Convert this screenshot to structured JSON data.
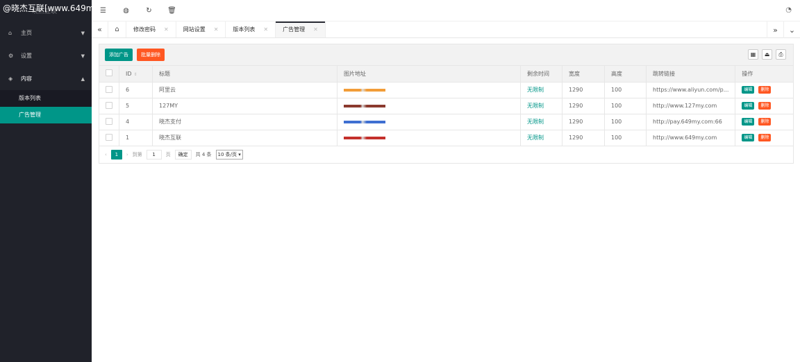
{
  "watermark": "@晓杰互联[www.649m",
  "sidebar": {
    "logo": "晓杰互联",
    "items": [
      {
        "label": "主页",
        "icon": "home-icon"
      },
      {
        "label": "设置",
        "icon": "settings-icon"
      },
      {
        "label": "内容",
        "icon": "diamond-icon"
      }
    ],
    "subitems": [
      {
        "label": "版本列表"
      },
      {
        "label": "广告管理"
      }
    ]
  },
  "tabs": [
    {
      "label": "修改密码"
    },
    {
      "label": "网站设置"
    },
    {
      "label": "版本列表"
    },
    {
      "label": "广告管理"
    }
  ],
  "toolbar": {
    "add_label": "添加广告",
    "batch_delete_label": "批量删除"
  },
  "table": {
    "headers": [
      "ID",
      "标题",
      "图片地址",
      "剩余时间",
      "宽度",
      "高度",
      "跳转链接",
      "操作"
    ],
    "rows": [
      {
        "id": "6",
        "title": "阿里云",
        "remaining": "无限制",
        "width": "1290",
        "height": "100",
        "link": "https://www.aliyun.com/p...",
        "img_color": "#f29d38"
      },
      {
        "id": "5",
        "title": "127MY",
        "remaining": "无限制",
        "width": "1290",
        "height": "100",
        "link": "http://www.127my.com",
        "img_color": "#8b3a2e"
      },
      {
        "id": "4",
        "title": "晓杰支付",
        "remaining": "无限制",
        "width": "1290",
        "height": "100",
        "link": "http://pay.649my.com:66",
        "img_color": "#3f6fd1"
      },
      {
        "id": "1",
        "title": "晓杰互联",
        "remaining": "无限制",
        "width": "1290",
        "height": "100",
        "link": "http://www.649my.com",
        "img_color": "#c4302b"
      }
    ],
    "edit_label": "编辑",
    "delete_label": "删除"
  },
  "pager": {
    "current": "1",
    "goto_label": "到第",
    "page_input": "1",
    "page_unit": "页",
    "confirm_label": "确定",
    "total": "共 4 条",
    "per_page": "10 条/页"
  }
}
